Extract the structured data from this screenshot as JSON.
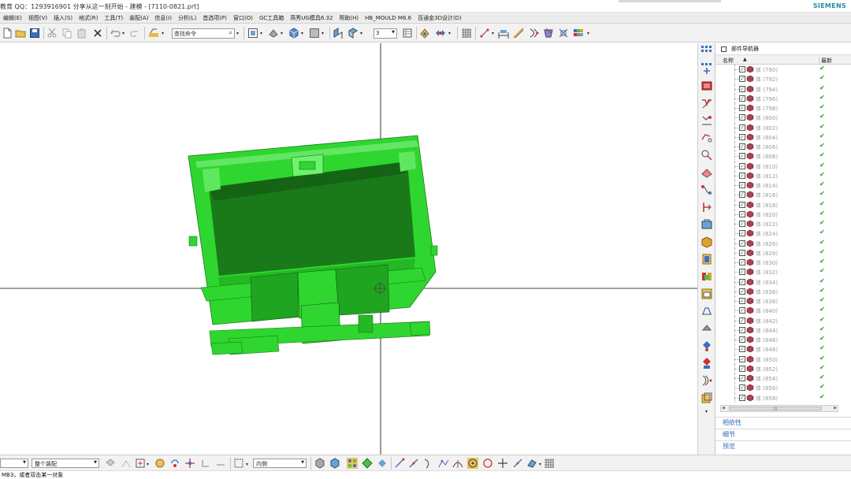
{
  "window": {
    "title": "教育 QQ：1293916901 分享从这一刻开始 - 建模 - [7110-0821.prt]",
    "brand": "SIEMENS"
  },
  "menu": [
    "编辑(E)",
    "视图(V)",
    "插入(S)",
    "格式(R)",
    "工具(T)",
    "装配(A)",
    "信息(I)",
    "分析(L)",
    "首选项(P)",
    "窗口(O)",
    "GC工具箱",
    "燕秀UG模具6.32",
    "帮助(H)",
    "HB_MOULD M6.6",
    "百通金3D设计(D)"
  ],
  "toolbar": {
    "search_placeholder": "查找命令",
    "number_field": "3",
    "icons": [
      "new-file-icon",
      "open-file-icon",
      "save-icon",
      "cut-icon",
      "copy-icon",
      "paste-icon",
      "delete-icon",
      "undo-icon",
      "redo-icon",
      "command-finder-icon",
      "fit-view-icon",
      "orient-view-icon",
      "render-style-icon",
      "background-icon",
      "section-view-icon",
      "snap-view-icon",
      "layer-icon",
      "show-hide-icon",
      "selection-filter-icon",
      "grid-icon",
      "measure-distance-icon",
      "measure-length-icon",
      "curve-analysis-icon",
      "face-analysis-icon",
      "mold-tool-icon",
      "color-table-icon"
    ]
  },
  "right_strip_icons": [
    "assembly-navigator-icon",
    "constraint-navigator-icon",
    "part-navigator-icon",
    "reuse-library-icon",
    "web-browser-icon",
    "history-icon",
    "system-materials-icon",
    "roles-icon",
    "process-studio-icon",
    "hd3d-tools-icon",
    "sketch-icon",
    "datum-plane-icon",
    "feature-group-icon",
    "mirror-body-icon",
    "sheet-body-icon",
    "color-icon",
    "palette-icon",
    "measure-icon",
    "section-icon",
    "layout-icon",
    "pattern-icon",
    "wave-icon",
    "expression-icon",
    "move-object-icon",
    "boolean-icon",
    "package-icon"
  ],
  "part_navigator": {
    "title": "部件导航器",
    "col_name": "名称",
    "col_latest": "最新",
    "rows": [
      {
        "label": "体 (790)",
        "latest": "✔"
      },
      {
        "label": "体 (792)",
        "latest": "✔"
      },
      {
        "label": "体 (794)",
        "latest": "✔"
      },
      {
        "label": "体 (796)",
        "latest": "✔"
      },
      {
        "label": "体 (798)",
        "latest": "✔"
      },
      {
        "label": "体 (800)",
        "latest": "✔"
      },
      {
        "label": "体 (802)",
        "latest": "✔"
      },
      {
        "label": "体 (804)",
        "latest": "✔"
      },
      {
        "label": "体 (806)",
        "latest": "✔"
      },
      {
        "label": "体 (808)",
        "latest": "✔"
      },
      {
        "label": "体 (810)",
        "latest": "✔"
      },
      {
        "label": "体 (812)",
        "latest": "✔"
      },
      {
        "label": "体 (814)",
        "latest": "✔"
      },
      {
        "label": "体 (816)",
        "latest": "✔"
      },
      {
        "label": "体 (818)",
        "latest": "✔"
      },
      {
        "label": "体 (820)",
        "latest": "✔"
      },
      {
        "label": "体 (822)",
        "latest": "✔"
      },
      {
        "label": "体 (824)",
        "latest": "✔"
      },
      {
        "label": "体 (826)",
        "latest": "✔"
      },
      {
        "label": "体 (828)",
        "latest": "✔"
      },
      {
        "label": "体 (830)",
        "latest": "✔"
      },
      {
        "label": "体 (832)",
        "latest": "✔"
      },
      {
        "label": "体 (834)",
        "latest": "✔"
      },
      {
        "label": "体 (836)",
        "latest": "✔"
      },
      {
        "label": "体 (838)",
        "latest": "✔"
      },
      {
        "label": "体 (840)",
        "latest": "✔"
      },
      {
        "label": "体 (842)",
        "latest": "✔"
      },
      {
        "label": "体 (844)",
        "latest": "✔"
      },
      {
        "label": "体 (846)",
        "latest": "✔"
      },
      {
        "label": "体 (848)",
        "latest": "✔"
      },
      {
        "label": "体 (850)",
        "latest": "✔"
      },
      {
        "label": "体 (852)",
        "latest": "✔"
      },
      {
        "label": "体 (854)",
        "latest": "✔"
      },
      {
        "label": "体 (856)",
        "latest": "✔"
      },
      {
        "label": "体 (858)",
        "latest": "✔"
      }
    ],
    "hscroll_grip": "|||",
    "sections": [
      "相依性",
      "细节",
      "预览"
    ]
  },
  "bottom_toolbar": {
    "filter_value": "整个装配",
    "scope_value": "内侧"
  },
  "status": {
    "prompt": "MB3，或者双击某一对象"
  },
  "colors": {
    "model_green": "#2fd62f",
    "dark_green": "#1a7a1a",
    "checkmark_green": "#19a019",
    "link_blue": "#2a6db0",
    "brand_teal": "#1e8fa0"
  }
}
